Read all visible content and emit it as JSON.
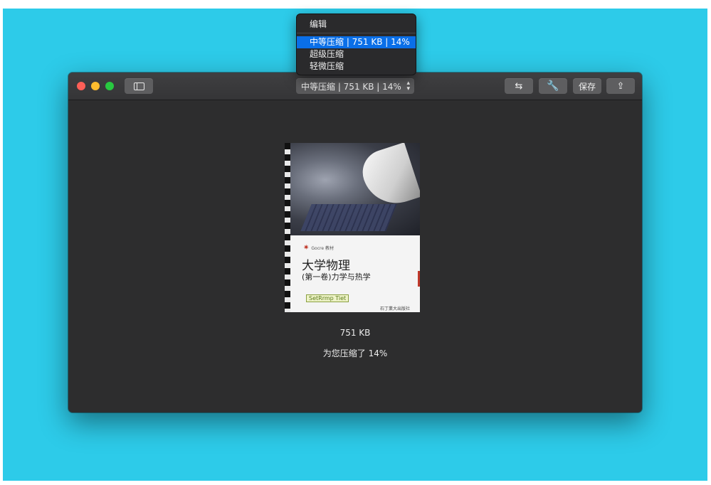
{
  "toolbar": {
    "compression_selector": "中等压缩 | 751 KB | 14%",
    "save_label": "保存"
  },
  "dropdown_menu": {
    "header": "编辑",
    "items": [
      {
        "label": "中等压缩 | 751 KB | 14%",
        "selected": true
      },
      {
        "label": "超级压缩",
        "selected": false
      },
      {
        "label": "轻微压缩",
        "selected": false
      }
    ]
  },
  "preview": {
    "title_main": "大学物理",
    "title_sub": "(第一卷)力学与热学",
    "publisher_series": "Gocre 教材",
    "stamp_text": "SetRrmp Tiet",
    "publisher": "石丁業大出版社"
  },
  "result": {
    "file_size": "751 KB",
    "saved_message": "为您压缩了 14%"
  },
  "colors": {
    "accent_selected": "#0a6fe8",
    "desktop_background": "#2dcbe9",
    "window_background": "#2d2d2e"
  }
}
